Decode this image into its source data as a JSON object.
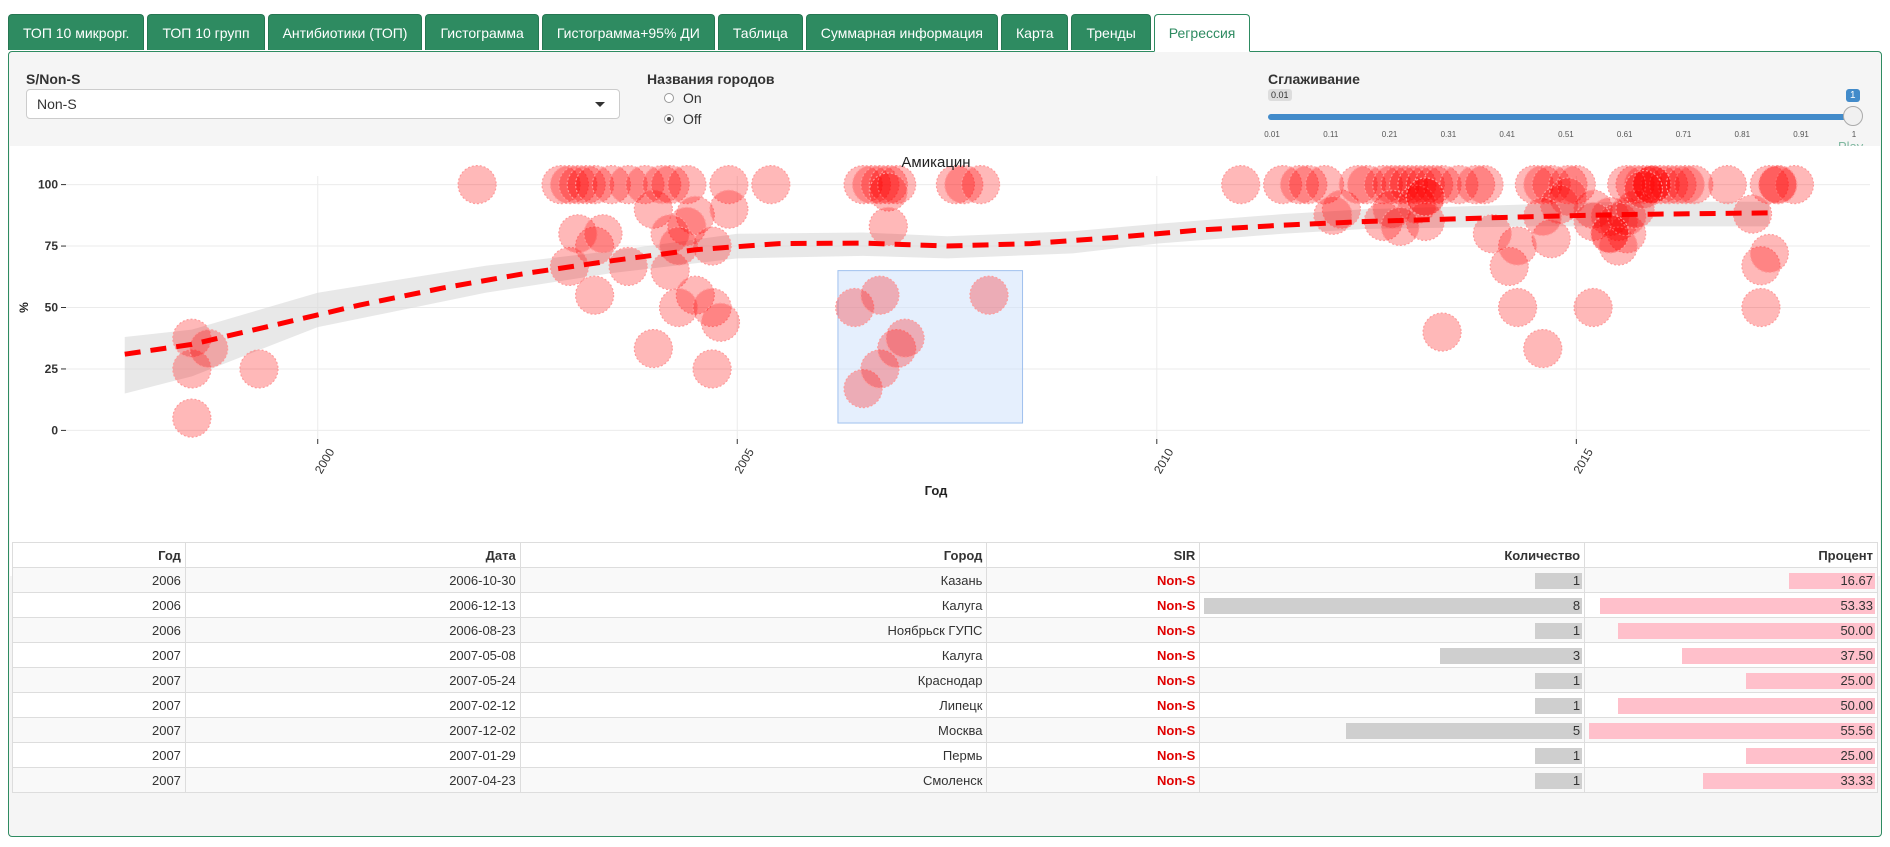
{
  "tabs": [
    {
      "label": "ТОП 10 микрорг.",
      "active": false
    },
    {
      "label": "ТОП 10 групп",
      "active": false
    },
    {
      "label": "Антибиотики (ТОП)",
      "active": false
    },
    {
      "label": "Гистограмма",
      "active": false
    },
    {
      "label": "Гистограмма+95% ДИ",
      "active": false
    },
    {
      "label": "Таблица",
      "active": false
    },
    {
      "label": "Суммарная информация",
      "active": false
    },
    {
      "label": "Карта",
      "active": false
    },
    {
      "label": "Тренды",
      "active": false
    },
    {
      "label": "Регрессия",
      "active": true
    }
  ],
  "controls": {
    "sir_label": "S/Non-S",
    "sir_value": "Non-S",
    "cities_label": "Названия городов",
    "cities_options": [
      {
        "label": "On",
        "checked": false
      },
      {
        "label": "Off",
        "checked": true
      }
    ],
    "smoothing_label": "Сглаживание",
    "smoothing_min": "0.01",
    "smoothing_value": "1",
    "smoothing_ticks": [
      "0.01",
      "0.11",
      "0.21",
      "0.31",
      "0.41",
      "0.51",
      "0.61",
      "0.71",
      "0.81",
      "0.91",
      "1"
    ],
    "play_label": "Play"
  },
  "colors": {
    "accent": "#2e8b61",
    "point": "#ff0000",
    "trend": "#ff0000",
    "ribbon": "#d9d9d9",
    "selection": "#cfe2fb",
    "sir_text": "#e00000",
    "bar_gray": "#cfcfcf",
    "bar_pink": "#ffc0cb"
  },
  "chart_data": {
    "type": "scatter",
    "title": "Амикацин",
    "xlabel": "Год",
    "ylabel": "%",
    "xlim": [
      1997,
      2018.5
    ],
    "ylim": [
      0,
      100
    ],
    "x_ticks": [
      2000,
      2005,
      2010,
      2015
    ],
    "y_ticks": [
      0,
      25,
      50,
      75,
      100
    ],
    "grid": true,
    "legend": "none",
    "series": [
      {
        "x": [
          1998.5,
          1998.5,
          1998.5,
          1998.7,
          1999.3,
          2001.9,
          2002.9,
          2003.0,
          2003.1,
          2003.2,
          2003.3,
          2003.3,
          2003.0,
          2003.1,
          2003.4,
          2003.5,
          2003.3,
          2003.7,
          2003.7,
          2003.9,
          2004.0,
          2004.1,
          2004.2,
          2004.4,
          2004.5,
          2004.4,
          2004.2,
          2004.2,
          2004.3,
          2004.5,
          2004.0,
          2004.3,
          2004.7,
          2004.7,
          2004.9,
          2004.9,
          2004.7,
          2004.8,
          2005.4,
          2006.4,
          2006.5,
          2006.6,
          2006.7,
          2006.7,
          2006.8,
          2006.9,
          2006.8,
          2006.8,
          2006.5,
          2006.7,
          2006.9,
          2007.0,
          2007.6,
          2007.7,
          2007.9,
          2008.0,
          2011.0,
          2011.5,
          2011.7,
          2011.8,
          2012.0,
          2012.2,
          2012.1,
          2012.4,
          2012.5,
          2012.7,
          2012.7,
          2012.8,
          2012.9,
          2013.0,
          2013.1,
          2013.2,
          2013.3,
          2013.4,
          2013.6,
          2013.8,
          2013.9,
          2012.8,
          2013.1,
          2013.2,
          2013.2,
          2012.9,
          2013.2,
          2013.4,
          2014.3,
          2014.5,
          2014.6,
          2014.7,
          2014.9,
          2015.0,
          2015.2,
          2015.4,
          2015.5,
          2015.6,
          2015.7,
          2015.8,
          2015.9,
          2016.0,
          2016.1,
          2016.2,
          2014.8,
          2014.9,
          2014.7,
          2015.2,
          2015.4,
          2015.5,
          2015.6,
          2015.7,
          2015.9,
          2014.2,
          2014.6,
          2014.3,
          2015.2,
          2015.4,
          2015.6,
          2015.9,
          2016.4,
          2016.8,
          2017.2,
          2017.3,
          2017.4,
          2017.3,
          2017.1,
          2017.2,
          2017.6,
          2017.4,
          2015.8,
          2014.6,
          2014.0,
          2016.3
        ],
        "y": [
          25,
          37.5,
          5,
          33.3,
          25,
          100,
          100,
          100,
          100,
          100,
          100,
          75,
          66.7,
          80,
          80,
          100,
          55,
          66.7,
          100,
          100,
          90,
          100,
          100,
          100,
          87.5,
          83,
          80,
          65,
          75,
          55,
          33.3,
          50,
          50,
          25,
          100,
          90,
          75,
          44,
          100,
          50,
          100,
          100,
          100,
          55,
          100,
          100,
          97,
          83,
          17,
          25,
          33.3,
          37.5,
          100,
          100,
          100,
          55,
          100,
          100,
          100,
          100,
          100,
          90,
          87.5,
          100,
          100,
          100,
          85,
          100,
          100,
          100,
          100,
          100,
          100,
          100,
          100,
          100,
          100,
          90,
          92,
          95,
          85,
          83,
          95,
          40,
          50,
          100,
          100,
          100,
          100,
          100,
          90,
          87,
          85,
          80,
          100,
          100,
          100,
          100,
          100,
          100,
          92,
          95,
          78,
          85,
          80,
          75,
          87,
          90,
          100,
          66.7,
          33.3,
          75,
          50,
          80,
          100,
          100,
          100,
          100,
          67,
          100,
          100,
          72,
          88,
          50,
          100,
          100,
          98,
          87,
          80,
          100
        ]
      },
      {
        "name": "trend",
        "x": [
          1997.7,
          1998.5,
          1999.5,
          2000.5,
          2001.5,
          2002.5,
          2003.5,
          2004.5,
          2005.5,
          2006.5,
          2007.5,
          2008.5,
          2009.5,
          2010.5,
          2011.5,
          2012.5,
          2013.5,
          2014.5,
          2015.5,
          2016.5,
          2017.3
        ],
        "y": [
          31,
          35,
          43,
          51,
          58,
          64,
          69,
          73.5,
          76,
          76.2,
          75,
          76,
          78.5,
          81.5,
          83.5,
          85,
          86,
          87,
          87.8,
          88.2,
          88.5
        ]
      }
    ],
    "ribbon": {
      "x": [
        1997.7,
        1998.5,
        2000,
        2002,
        2003.5,
        2005,
        2006.5,
        2007.5,
        2009,
        2010,
        2011.5,
        2012.5,
        2013.5,
        2014.5,
        2015.5,
        2016.5,
        2017.3
      ],
      "upper": [
        38,
        41,
        56,
        67,
        73,
        80,
        80.5,
        79,
        81,
        84,
        88,
        90,
        91,
        92,
        93,
        93,
        93
      ],
      "lower": [
        15,
        22,
        42,
        56,
        64,
        70,
        71,
        70,
        72,
        76,
        80,
        82,
        82.5,
        83,
        83,
        83,
        83
      ]
    },
    "selection": {
      "x": [
        2006.2,
        2008.4
      ],
      "y": [
        3,
        65
      ]
    }
  },
  "table": {
    "headers": [
      "Год",
      "Дата",
      "Город",
      "SIR",
      "Количество",
      "Процент"
    ],
    "max_count": 8,
    "max_percent": 55.56,
    "rows": [
      {
        "year": "2006",
        "date": "2006-10-30",
        "city": "Казань",
        "sir": "Non-S",
        "count": "1",
        "percent": "16.67"
      },
      {
        "year": "2006",
        "date": "2006-12-13",
        "city": "Калуга",
        "sir": "Non-S",
        "count": "8",
        "percent": "53.33"
      },
      {
        "year": "2006",
        "date": "2006-08-23",
        "city": "Ноябрьск ГУПС",
        "sir": "Non-S",
        "count": "1",
        "percent": "50.00"
      },
      {
        "year": "2007",
        "date": "2007-05-08",
        "city": "Калуга",
        "sir": "Non-S",
        "count": "3",
        "percent": "37.50"
      },
      {
        "year": "2007",
        "date": "2007-05-24",
        "city": "Краснодар",
        "sir": "Non-S",
        "count": "1",
        "percent": "25.00"
      },
      {
        "year": "2007",
        "date": "2007-02-12",
        "city": "Липецк",
        "sir": "Non-S",
        "count": "1",
        "percent": "50.00"
      },
      {
        "year": "2007",
        "date": "2007-12-02",
        "city": "Москва",
        "sir": "Non-S",
        "count": "5",
        "percent": "55.56"
      },
      {
        "year": "2007",
        "date": "2007-01-29",
        "city": "Пермь",
        "sir": "Non-S",
        "count": "1",
        "percent": "25.00"
      },
      {
        "year": "2007",
        "date": "2007-04-23",
        "city": "Смоленск",
        "sir": "Non-S",
        "count": "1",
        "percent": "33.33"
      }
    ]
  }
}
